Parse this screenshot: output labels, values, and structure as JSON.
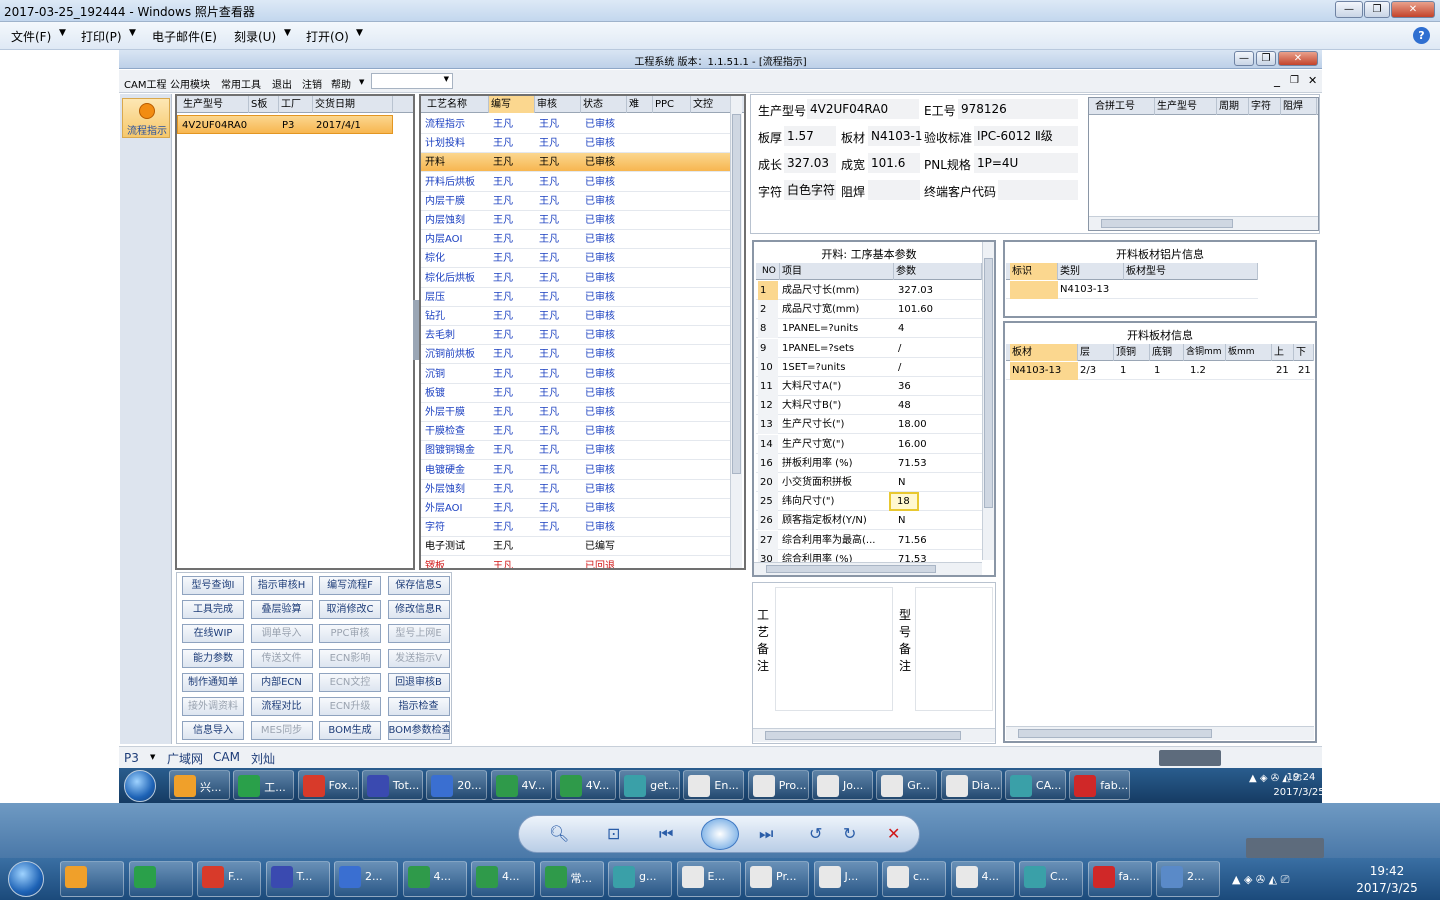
{
  "viewer": {
    "title": "2017-03-25_192444 - Windows 照片查看器",
    "menu": [
      "文件(F)",
      "打印(P)",
      "电子邮件(E)",
      "刻录(U)",
      "打开(O)"
    ]
  },
  "app": {
    "title": "工程系统  版本：1.1.51.1 - [流程指示]",
    "menu": [
      "CAM工程",
      "公用模块",
      "常用工具",
      "退出",
      "注销",
      "帮助"
    ],
    "nav_label": "流程指示"
  },
  "orders": {
    "headers": [
      "生产型号",
      "S板",
      "工厂",
      "交货日期"
    ],
    "rows": [
      [
        "4V2UF04RA0",
        "",
        "P3",
        "2017/4/1"
      ]
    ]
  },
  "process": {
    "headers": [
      "工艺名称",
      "编写",
      "审核",
      "状态",
      "难",
      "PPC",
      "文控"
    ],
    "rows": [
      {
        "name": "流程指示",
        "writer": "王凡",
        "reviewer": "王凡",
        "status": "已审核"
      },
      {
        "name": "计划投料",
        "writer": "王凡",
        "reviewer": "王凡",
        "status": "已审核"
      },
      {
        "name": "开料",
        "writer": "王凡",
        "reviewer": "王凡",
        "status": "已审核"
      },
      {
        "name": "开料后烘板",
        "writer": "王凡",
        "reviewer": "王凡",
        "status": "已审核"
      },
      {
        "name": "内层干膜",
        "writer": "王凡",
        "reviewer": "王凡",
        "status": "已审核"
      },
      {
        "name": "内层蚀刻",
        "writer": "王凡",
        "reviewer": "王凡",
        "status": "已审核"
      },
      {
        "name": "内层AOI",
        "writer": "王凡",
        "reviewer": "王凡",
        "status": "已审核"
      },
      {
        "name": "棕化",
        "writer": "王凡",
        "reviewer": "王凡",
        "status": "已审核"
      },
      {
        "name": "棕化后烘板",
        "writer": "王凡",
        "reviewer": "王凡",
        "status": "已审核"
      },
      {
        "name": "层压",
        "writer": "王凡",
        "reviewer": "王凡",
        "status": "已审核"
      },
      {
        "name": "钻孔",
        "writer": "王凡",
        "reviewer": "王凡",
        "status": "已审核"
      },
      {
        "name": "去毛刺",
        "writer": "王凡",
        "reviewer": "王凡",
        "status": "已审核"
      },
      {
        "name": "沉铜前烘板",
        "writer": "王凡",
        "reviewer": "王凡",
        "status": "已审核"
      },
      {
        "name": "沉铜",
        "writer": "王凡",
        "reviewer": "王凡",
        "status": "已审核"
      },
      {
        "name": "板镀",
        "writer": "王凡",
        "reviewer": "王凡",
        "status": "已审核"
      },
      {
        "name": "外层干膜",
        "writer": "王凡",
        "reviewer": "王凡",
        "status": "已审核"
      },
      {
        "name": "干膜检查",
        "writer": "王凡",
        "reviewer": "王凡",
        "status": "已审核"
      },
      {
        "name": "图镀铜锡金",
        "writer": "王凡",
        "reviewer": "王凡",
        "status": "已审核"
      },
      {
        "name": "电镀硬金",
        "writer": "王凡",
        "reviewer": "王凡",
        "status": "已审核"
      },
      {
        "name": "外层蚀刻",
        "writer": "王凡",
        "reviewer": "王凡",
        "status": "已审核"
      },
      {
        "name": "外层AOI",
        "writer": "王凡",
        "reviewer": "王凡",
        "status": "已审核"
      },
      {
        "name": "字符",
        "writer": "王凡",
        "reviewer": "王凡",
        "status": "已审核"
      },
      {
        "name": "电子测试",
        "writer": "王凡",
        "reviewer": "",
        "status": "已编写"
      },
      {
        "name": "锣板",
        "writer": "王凡",
        "reviewer": "",
        "status": "已回退"
      }
    ]
  },
  "buttons": [
    [
      "型号查询Ⅰ",
      "指示审核H",
      "编写流程F",
      "保存信息S"
    ],
    [
      "工具完成",
      "叠层验算",
      "取消修改C",
      "修改信息R"
    ],
    [
      "在线WIP",
      "调单导入",
      "PPC审核",
      "型号上网E"
    ],
    [
      "能力参数",
      "传送文件",
      "ECN影响",
      "发送指示V"
    ],
    [
      "制作通知单",
      "内部ECN",
      "ECN文控",
      "回退审核B"
    ],
    [
      "接外调资料",
      "流程对比",
      "ECN升级",
      "指示检查"
    ],
    [
      "信息导入",
      "MES同步",
      "BOM生成",
      "BOM参数检查"
    ]
  ],
  "info": {
    "model_label": "生产型号",
    "model": "4V2UF04RA0",
    "eng_label": "E工号",
    "eng": "978126",
    "thick_label": "板厚",
    "thick": "1.57",
    "mat_label": "板材",
    "mat": "N4103-1",
    "std_label": "验收标准",
    "std": "IPC-6012 Ⅱ级",
    "len_label": "成长",
    "len": "327.03",
    "wid_label": "成宽",
    "wid": "101.6",
    "pnl_label": "PNL规格",
    "pnl": "1P=4U",
    "char_label": "字符",
    "char": "白色字符",
    "mask_label": "阻焊",
    "mask": "",
    "cust_label": "终端客户代码",
    "cust": ""
  },
  "merge": {
    "headers": [
      "合拼工号",
      "生产型号",
      "周期",
      "字符",
      "阻焊"
    ]
  },
  "params": {
    "title": "开料: 工序基本参数",
    "headers": [
      "NO",
      "项目",
      "参数"
    ],
    "rows": [
      [
        "1",
        "成品尺寸长(mm)",
        "327.03"
      ],
      [
        "2",
        "成品尺寸宽(mm)",
        "101.60"
      ],
      [
        "8",
        "1PANEL=?units",
        "4"
      ],
      [
        "9",
        "1PANEL=?sets",
        "/"
      ],
      [
        "10",
        "1SET=?units",
        "/"
      ],
      [
        "11",
        "大料尺寸A(\")",
        "36"
      ],
      [
        "12",
        "大料尺寸B(\")",
        "48"
      ],
      [
        "13",
        "生产尺寸长(\")",
        "18.00"
      ],
      [
        "14",
        "生产尺寸宽(\")",
        "16.00"
      ],
      [
        "16",
        "拼板利用率 (%)",
        "71.53"
      ],
      [
        "20",
        "小交货面积拼板",
        "N"
      ],
      [
        "25",
        "纬向尺寸(\")",
        "18"
      ],
      [
        "26",
        "顾客指定板材(Y/N)",
        "N"
      ],
      [
        "27",
        "综合利用率为最高(...",
        "71.56"
      ],
      [
        "30",
        "综合利用率 (%)",
        "71.53"
      ]
    ]
  },
  "cutinfo": {
    "title": "开料板材铝片信息",
    "headers": [
      "标识",
      "类别",
      "板材型号"
    ],
    "rows": [
      [
        "",
        "N4103-13",
        ""
      ]
    ]
  },
  "sheetinfo": {
    "title": "开料板材信息",
    "headers": [
      "板材",
      "层",
      "顶铜",
      "底铜",
      "含铜mm",
      "板mm",
      "上",
      "下"
    ],
    "rows": [
      [
        "N4103-13",
        "2/3",
        "1",
        "1",
        "1.2",
        "",
        "21",
        "21"
      ]
    ]
  },
  "notes": {
    "process_label": "工艺备注",
    "model_label": "型号备注"
  },
  "status": {
    "factory": "P3",
    "net": "广域网",
    "module": "CAM",
    "user": "刘灿"
  },
  "taskbar_inner": {
    "items": [
      "兴...",
      "工...",
      "Fox...",
      "Tot...",
      "20...",
      "4V...",
      "4V...",
      "get...",
      "En...",
      "Pro...",
      "Jo...",
      "Gr...",
      "Dia...",
      "CA...",
      "fab..."
    ],
    "time": "19:24",
    "date": "2017/3/25"
  },
  "taskbar_outer": {
    "items": [
      "",
      "",
      "F...",
      "T...",
      "2...",
      "4...",
      "4...",
      "常...",
      "g...",
      "E...",
      "Pr...",
      "J...",
      "c...",
      "4...",
      "C...",
      "fa...",
      "2..."
    ],
    "time": "19:42",
    "date": "2017/3/25"
  },
  "colors": {
    "selected_row": "#f7b650",
    "link_blue": "#1a3fc0",
    "returned_red": "#d01818"
  }
}
